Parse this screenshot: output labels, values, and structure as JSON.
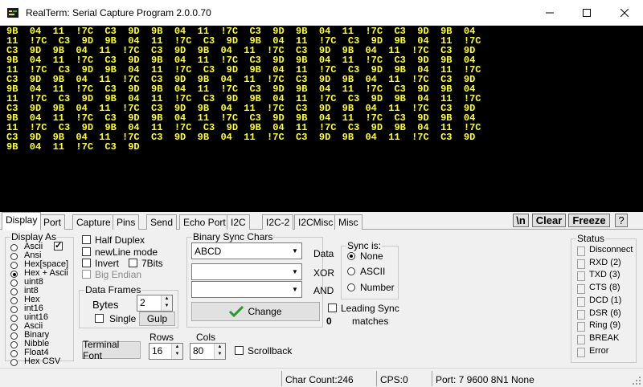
{
  "window": {
    "title": "RealTerm: Serial Capture Program 2.0.0.70"
  },
  "terminal": {
    "color": "#ffff2e",
    "lines": [
      "9B  04  11  !7C  C3  9D  9B  04  11  !7C  C3  9D  9B  04  11  !7C  C3  9D  9B  04",
      "11  !7C  C3  9D  9B  04  11  !7C  C3  9D  9B  04  11  !7C  C3  9D  9B  04  11  !7C",
      "C3  9D  9B  04  11  !7C  C3  9D  9B  04  11  !7C  C3  9D  9B  04  11  !7C  C3  9D",
      "9B  04  11  !7C  C3  9D  9B  04  11  !7C  C3  9D  9B  04  11  !7C  C3  9D  9B  04",
      "11  !7C  C3  9D  9B  04  11  !7C  C3  9D  9B  04  11  !7C  C3  9D  9B  04  11  !7C",
      "C3  9D  9B  04  11  !7C  C3  9D  9B  04  11  !7C  C3  9D  9B  04  11  !7C  C3  9D",
      "9B  04  11  !7C  C3  9D  9B  04  11  !7C  C3  9D  9B  04  11  !7C  C3  9D  9B  04",
      "11  !7C  C3  9D  9B  04  11  !7C  C3  9D  9B  04  11  !7C  C3  9D  9B  04  11  !7C",
      "C3  9D  9B  04  11  !7C  C3  9D  9B  04  11  !7C  C3  9D  9B  04  11  !7C  C3  9D",
      "9B  04  11  !7C  C3  9D  9B  04  11  !7C  C3  9D  9B  04  11  !7C  C3  9D  9B  04",
      "11  !7C  C3  9D  9B  04  11  !7C  C3  9D  9B  04  11  !7C  C3  9D  9B  04  11  !7C",
      "C3  9D  9B  04  11  !7C  C3  9D  9B  04  11  !7C  C3  9D  9B  04  11  !7C  C3  9D",
      "9B  04  11  !7C  C3  9D"
    ]
  },
  "tabs": [
    "Display",
    "Port",
    "Capture",
    "Pins",
    "Send",
    "Echo Port",
    "I2C",
    "I2C-2",
    "I2CMisc",
    "Misc"
  ],
  "toolbar": {
    "newline": "\\n",
    "clear": "Clear",
    "freeze": "Freeze",
    "help": "?"
  },
  "display_as": {
    "legend": "Display As",
    "options": [
      "Ascii",
      "Ansi",
      "Hex[space]",
      "Hex + Ascii",
      "uint8",
      "int8",
      "Hex",
      "int16",
      "uint16",
      "Ascii",
      "Binary",
      "Nibble",
      "Float4",
      "Hex CSV"
    ],
    "selected": "Hex + Ascii"
  },
  "options": {
    "half_duplex": "Half Duplex",
    "newline_mode": "newLine mode",
    "invert": "Invert",
    "7bits": "7Bits",
    "big_endian": "Big Endian"
  },
  "data_frames": {
    "legend": "Data Frames",
    "bytes_label": "Bytes",
    "bytes_value": "2",
    "single": "Single",
    "gulp": "Gulp"
  },
  "terminal_font": "Terminal Font",
  "rows": {
    "label": "Rows",
    "value": "16"
  },
  "cols": {
    "label": "Cols",
    "value": "80"
  },
  "scrollback": "Scrollback",
  "binary_sync": {
    "legend": "Binary Sync Chars",
    "data_value": "ABCD",
    "data_label": "Data",
    "xor_label": "XOR",
    "and_label": "AND",
    "change": "Change",
    "leading_sync": "Leading Sync",
    "matches_count": "0",
    "matches": "matches"
  },
  "sync_is": {
    "legend": "Sync is:",
    "options": [
      "None",
      "ASCII",
      "Number"
    ],
    "selected": "None"
  },
  "status": {
    "legend": "Status",
    "items": [
      "Disconnect",
      "RXD (2)",
      "TXD (3)",
      "CTS (8)",
      "DCD (1)",
      "DSR (6)",
      "Ring (9)",
      "BREAK",
      "Error"
    ]
  },
  "statusbar": {
    "char_count": "Char Count:246",
    "cps": "CPS:0",
    "port": "Port: 7 9600 8N1 None"
  }
}
